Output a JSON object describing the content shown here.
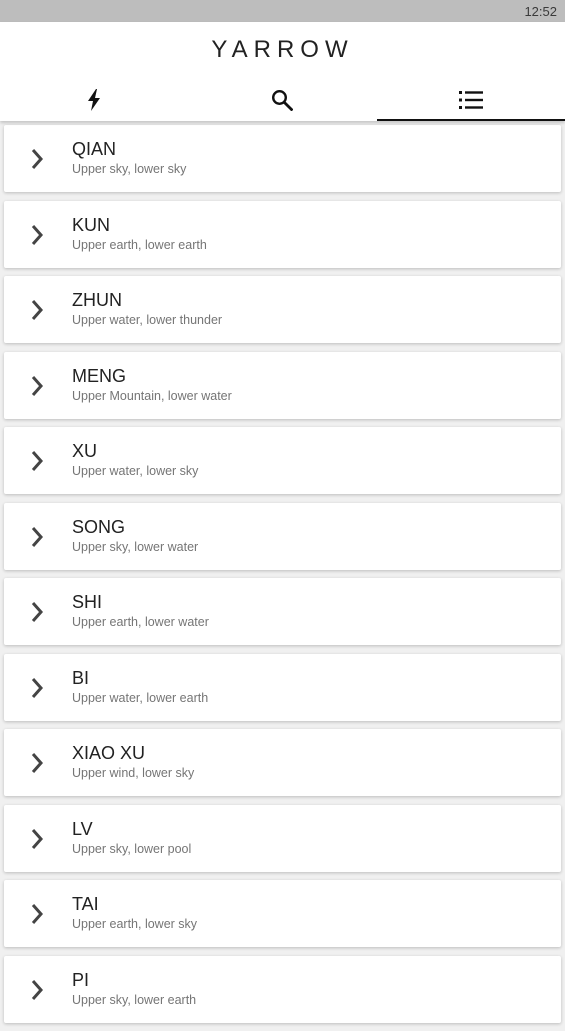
{
  "status_bar": {
    "time": "12:52"
  },
  "app": {
    "title": "YARROW"
  },
  "tabs": [
    {
      "icon": "lightning-icon",
      "active": false
    },
    {
      "icon": "search-icon",
      "active": false
    },
    {
      "icon": "list-icon",
      "active": true
    }
  ],
  "hexagrams": [
    {
      "title": "QIAN",
      "subtitle": "Upper sky, lower sky"
    },
    {
      "title": "KUN",
      "subtitle": "Upper earth, lower earth"
    },
    {
      "title": "ZHUN",
      "subtitle": "Upper water, lower thunder"
    },
    {
      "title": "MENG",
      "subtitle": "Upper Mountain, lower water"
    },
    {
      "title": "XU",
      "subtitle": "Upper water, lower sky"
    },
    {
      "title": "SONG",
      "subtitle": "Upper sky, lower water"
    },
    {
      "title": "SHI",
      "subtitle": "Upper earth, lower water"
    },
    {
      "title": "BI",
      "subtitle": "Upper water, lower earth"
    },
    {
      "title": "XIAO XU",
      "subtitle": "Upper wind, lower sky"
    },
    {
      "title": "LV",
      "subtitle": "Upper sky, lower pool"
    },
    {
      "title": "TAI",
      "subtitle": "Upper earth, lower sky"
    },
    {
      "title": "PI",
      "subtitle": "Upper sky, lower earth"
    }
  ]
}
